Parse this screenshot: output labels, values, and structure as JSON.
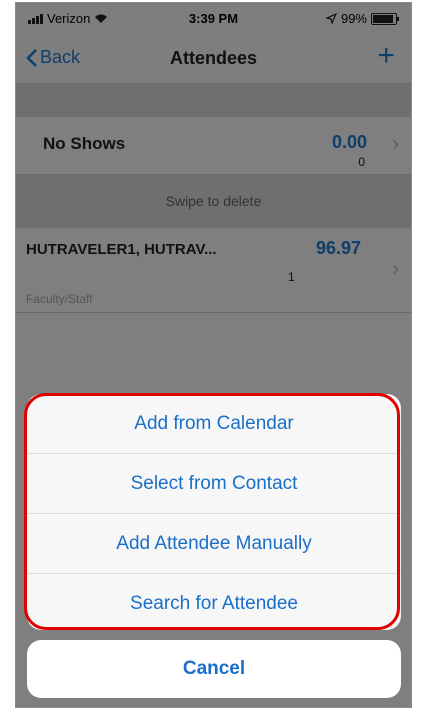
{
  "status_bar": {
    "carrier": "Verizon",
    "time": "3:39 PM",
    "battery_text": "99%",
    "battery_level": 0.99
  },
  "nav": {
    "back_label": "Back",
    "title": "Attendees"
  },
  "no_shows": {
    "label": "No Shows",
    "amount": "0.00",
    "count": "0"
  },
  "swipe_hint": "Swipe to delete",
  "attendee": {
    "name": "HUTRAVELER1, HUTRAV...",
    "amount": "96.97",
    "count": "1",
    "subtitle": "Faculty/Staff"
  },
  "action_sheet": {
    "options": [
      "Add from Calendar",
      "Select from Contact",
      "Add Attendee Manually",
      "Search for Attendee"
    ],
    "cancel_label": "Cancel"
  },
  "colors": {
    "accent": "#1a6fc9",
    "highlight": "#e00000"
  }
}
